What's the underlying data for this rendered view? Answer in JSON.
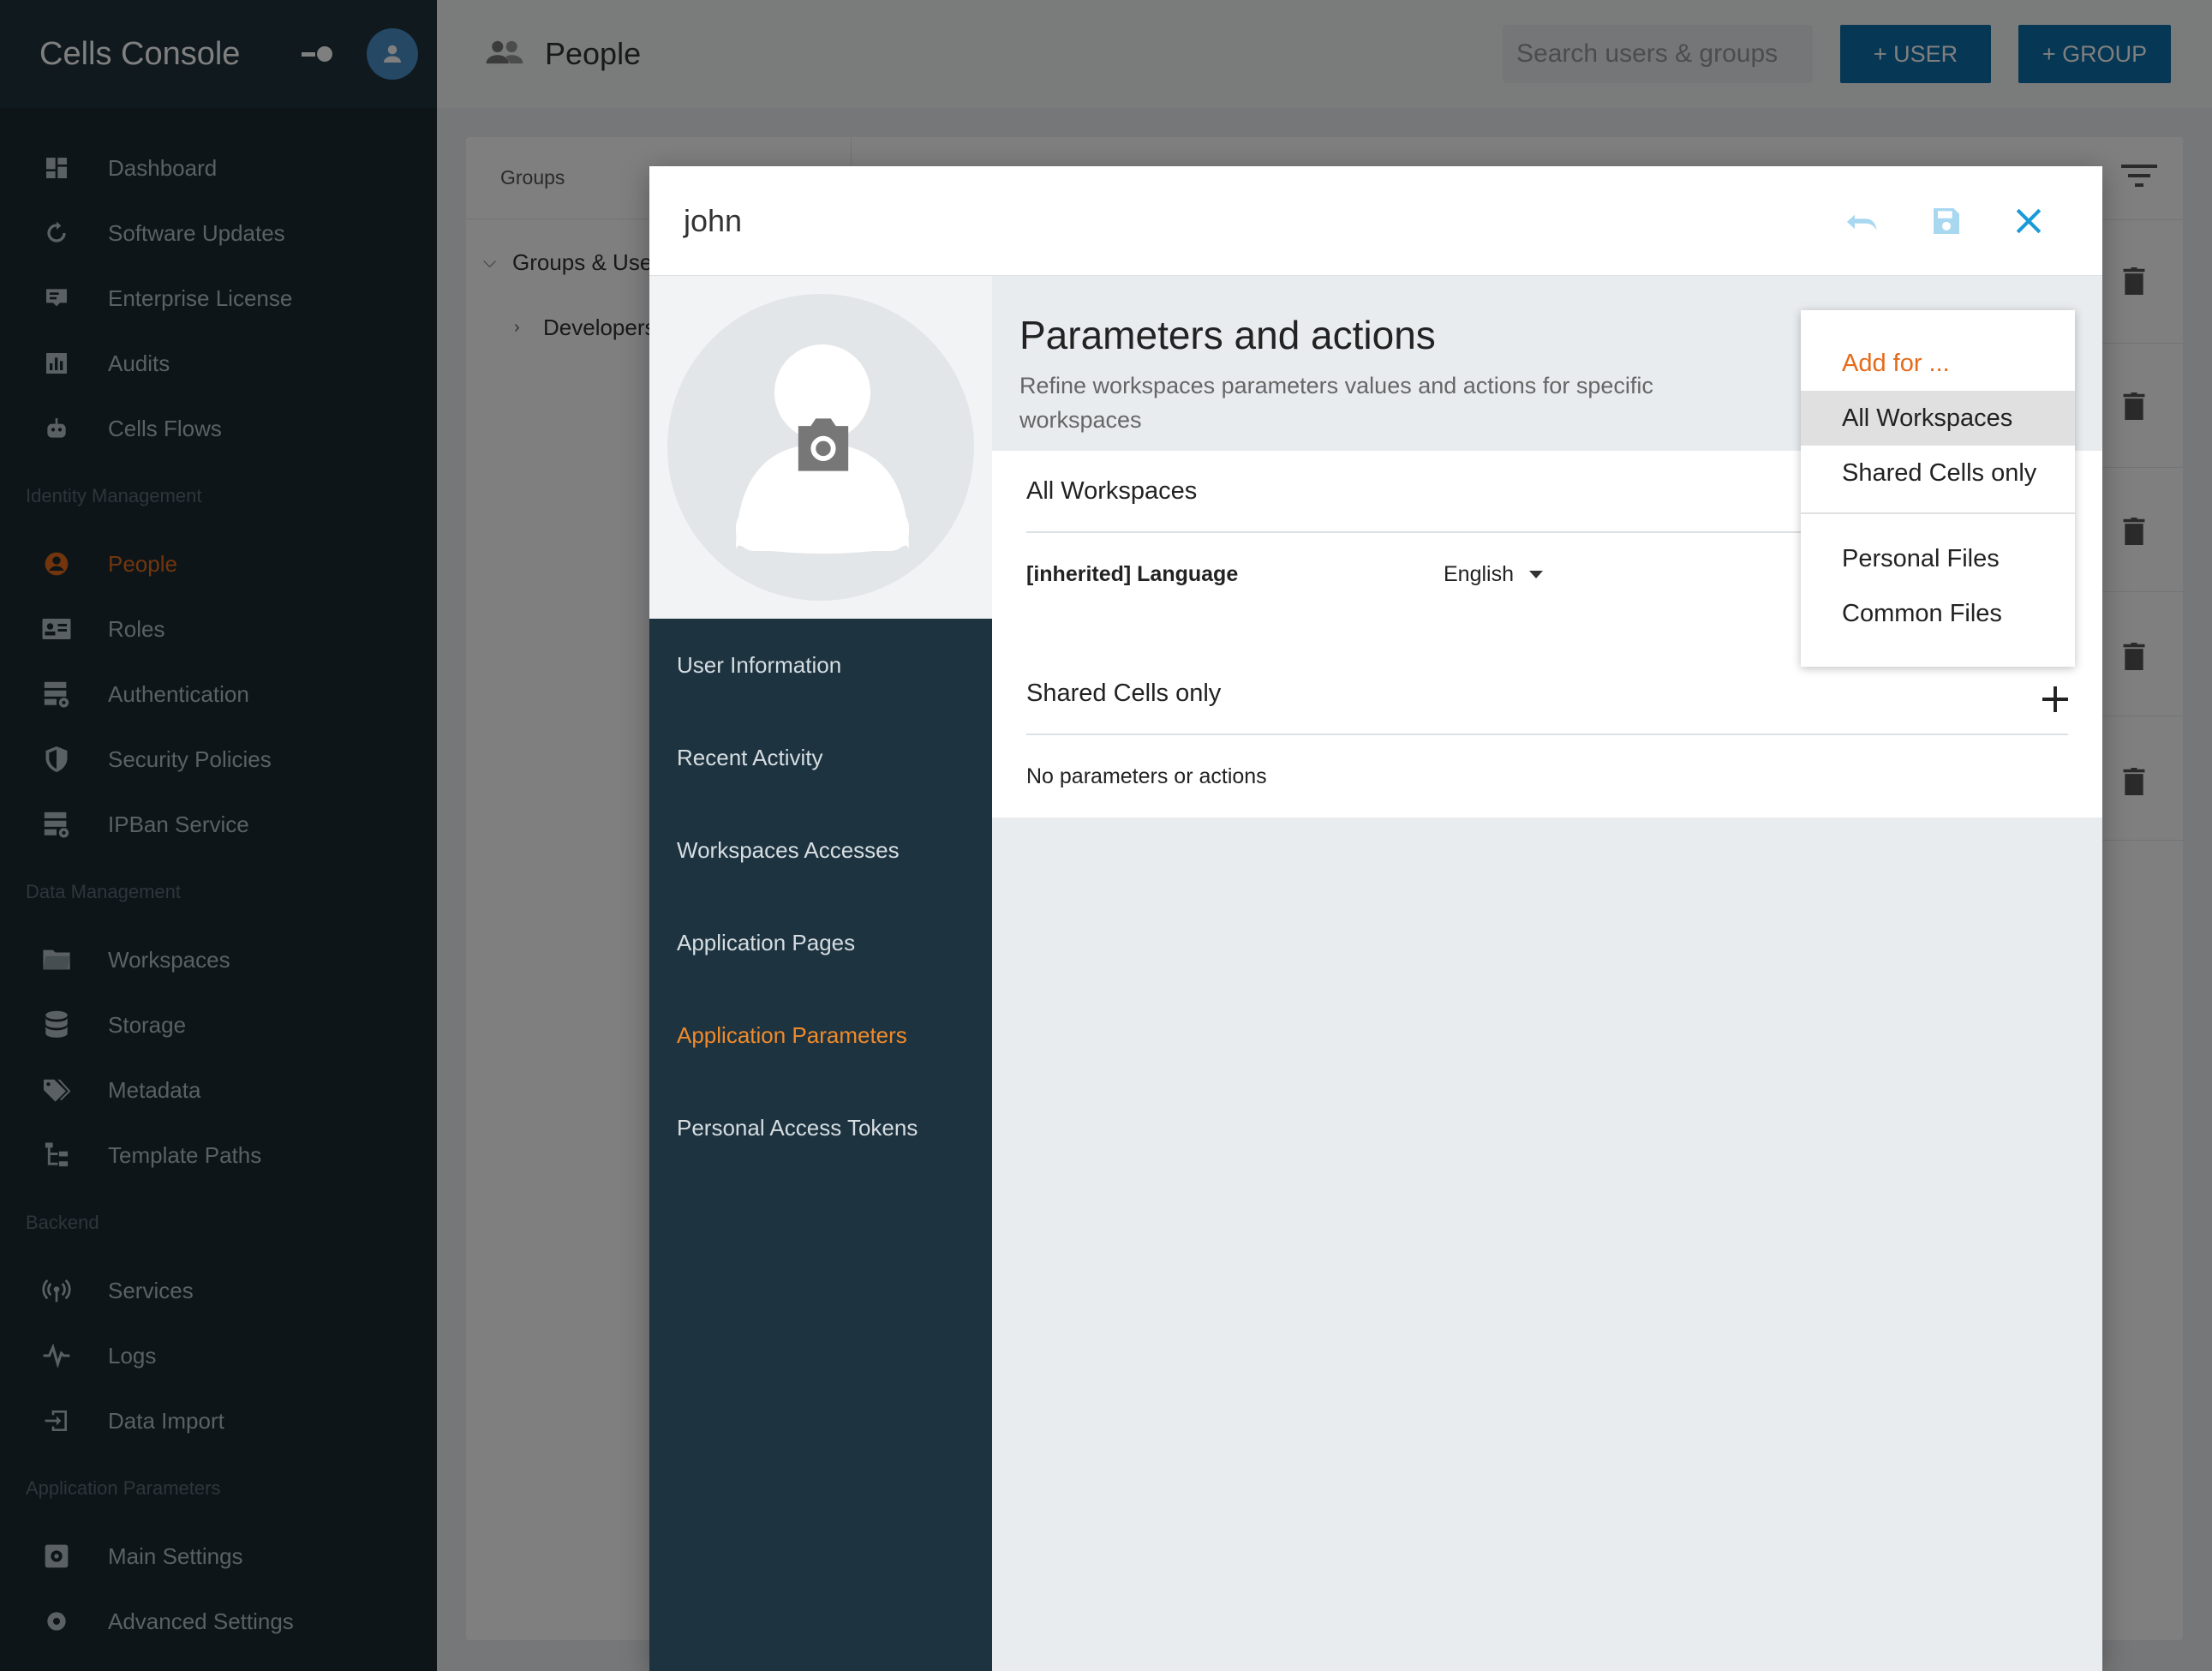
{
  "sidebar": {
    "app_title": "Cells Console",
    "toggle_icon": "toggle-icon",
    "avatar_icon": "user-avatar-icon",
    "items_top": [
      {
        "label": "Dashboard",
        "icon": "dashboard-icon"
      },
      {
        "label": "Software Updates",
        "icon": "update-icon"
      },
      {
        "label": "Enterprise License",
        "icon": "certificate-icon"
      },
      {
        "label": "Audits",
        "icon": "chart-icon"
      },
      {
        "label": "Cells Flows",
        "icon": "robot-icon"
      }
    ],
    "section_identity": "Identity Management",
    "items_identity": [
      {
        "label": "People",
        "icon": "person-icon",
        "active": true
      },
      {
        "label": "Roles",
        "icon": "id-card-icon"
      },
      {
        "label": "Authentication",
        "icon": "server-lock-icon"
      },
      {
        "label": "Security Policies",
        "icon": "shield-icon"
      },
      {
        "label": "IPBan Service",
        "icon": "server-lock-icon"
      }
    ],
    "section_data": "Data Management",
    "items_data": [
      {
        "label": "Workspaces",
        "icon": "folder-icon"
      },
      {
        "label": "Storage",
        "icon": "database-icon"
      },
      {
        "label": "Metadata",
        "icon": "tags-icon"
      },
      {
        "label": "Template Paths",
        "icon": "file-tree-icon"
      }
    ],
    "section_backend": "Backend",
    "items_backend": [
      {
        "label": "Services",
        "icon": "broadcast-icon"
      },
      {
        "label": "Logs",
        "icon": "pulse-icon"
      },
      {
        "label": "Data Import",
        "icon": "import-icon"
      }
    ],
    "section_app": "Application Parameters",
    "items_app": [
      {
        "label": "Main Settings",
        "icon": "settings-box-icon"
      },
      {
        "label": "Advanced Settings",
        "icon": "gear-icon"
      }
    ]
  },
  "topbar": {
    "title": "People",
    "search_placeholder": "Search users & groups",
    "add_user_label": "+ USER",
    "add_group_label": "+ GROUP"
  },
  "groups_panel": {
    "header": "Groups",
    "tree": [
      {
        "label": "Groups & Users",
        "expanded": true
      },
      {
        "label": "Developers",
        "expanded": false
      }
    ]
  },
  "modal": {
    "title": "john",
    "undo_icon": "undo-icon",
    "save_icon": "save-icon",
    "close_icon": "close-icon",
    "nav": [
      {
        "label": "User Information"
      },
      {
        "label": "Recent Activity"
      },
      {
        "label": "Workspaces Accesses"
      },
      {
        "label": "Application Pages"
      },
      {
        "label": "Application Parameters",
        "active": true
      },
      {
        "label": "Personal Access Tokens"
      }
    ],
    "params": {
      "title": "Parameters and actions",
      "subtitle": "Refine workspaces parameters values and actions for specific workspaces",
      "sections": [
        {
          "title": "All Workspaces",
          "rows": [
            {
              "label": "[inherited] Language",
              "value": "English"
            }
          ]
        },
        {
          "title": "Shared Cells only",
          "empty_text": "No parameters or actions"
        }
      ]
    }
  },
  "menu": {
    "header": "Add for ...",
    "items_group1": [
      "All Workspaces",
      "Shared Cells only"
    ],
    "items_group2": [
      "Personal Files",
      "Common Files"
    ],
    "highlighted": "All Workspaces"
  },
  "colors": {
    "accent_orange": "#E56A1B",
    "sidebar_bg": "#1B2B33",
    "primary_button": "#0D6FA8",
    "icon_blue": "#1A9BD7"
  }
}
